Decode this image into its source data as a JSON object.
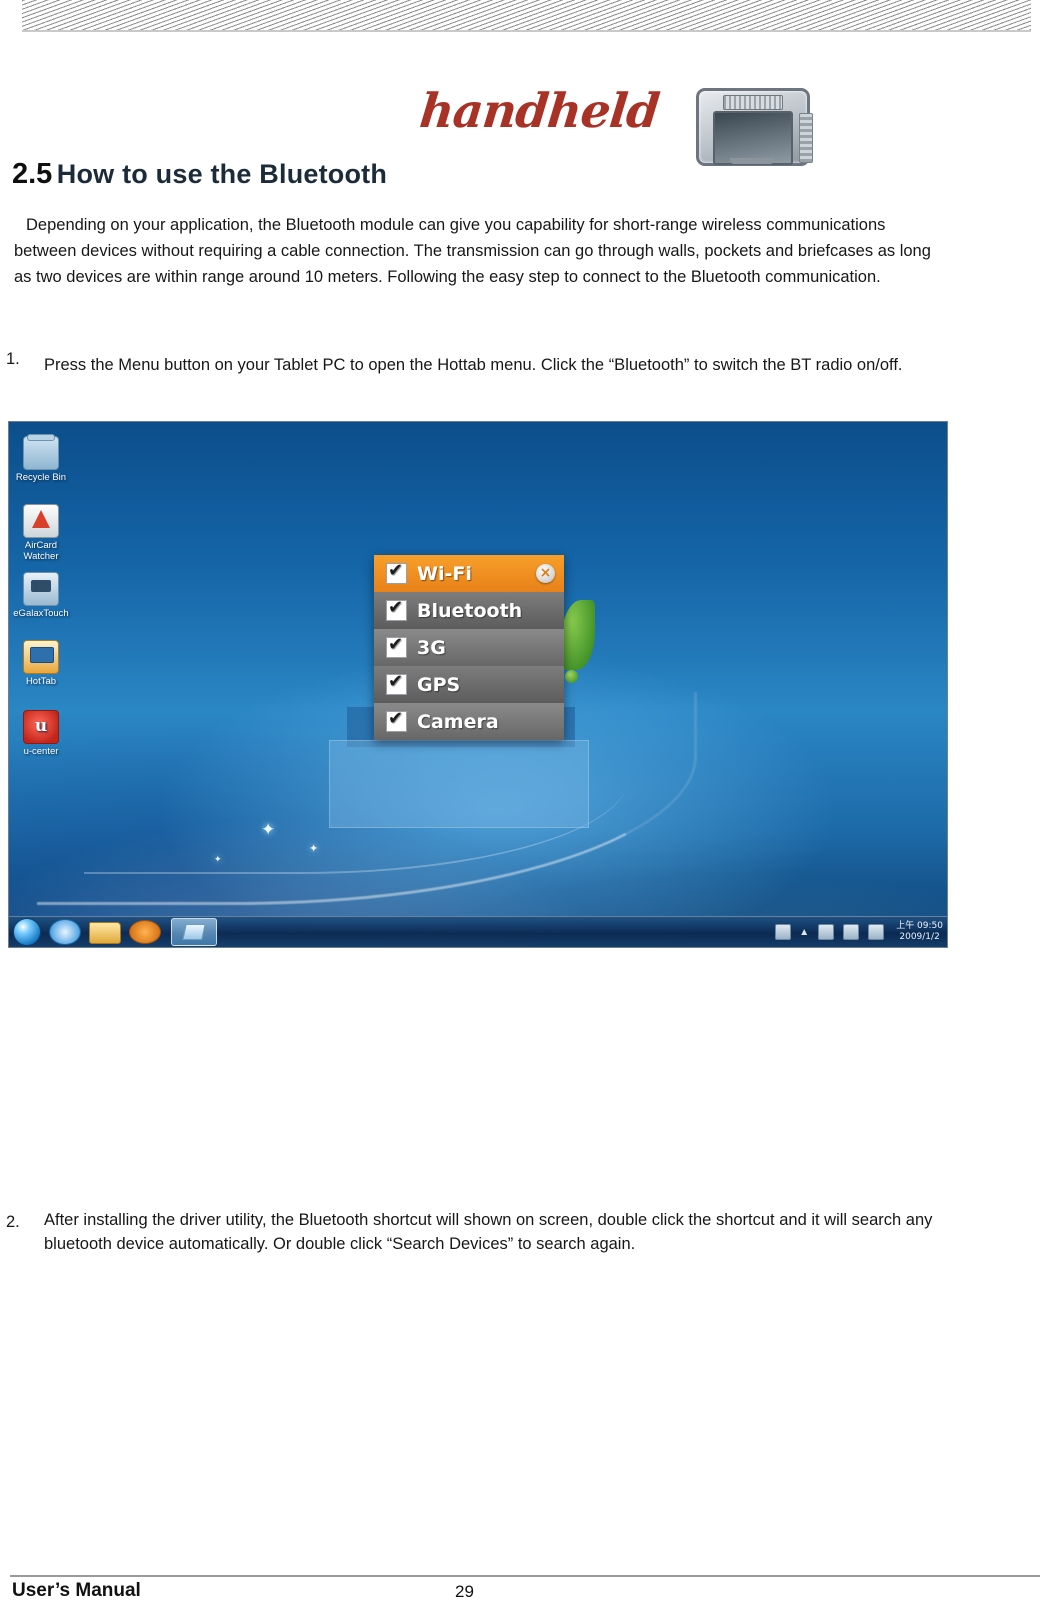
{
  "document": {
    "logo_text": "handheld",
    "heading_number": "2.5",
    "heading_title": "How to use the Bluetooth",
    "intro_paragraph": "Depending on your application, the Bluetooth module can give you capability for short-range wireless communications between devices without requiring a cable connection. The transmission can go through walls, pockets and briefcases as long as two devices are within range around 10 meters. Following the easy step to connect to the Bluetooth communication.",
    "steps": [
      {
        "number": "1.",
        "text": "Press the Menu button on your Tablet PC to open the Hottab menu. Click the “Bluetooth” to switch the BT radio on/off."
      },
      {
        "number": "2.",
        "text": "After installing the driver utility, the Bluetooth shortcut will shown on screen, double click the shortcut and it will search any bluetooth device automatically. Or double click “Search Devices” to search again."
      }
    ],
    "footer": {
      "left_label": "User’s Manual",
      "page_number": "29"
    }
  },
  "screenshot": {
    "desktop_icons": [
      {
        "label": "Recycle Bin",
        "icon": "recycle-bin-icon"
      },
      {
        "label": "AirCard\nWatcher",
        "icon": "aircard-watcher-icon"
      },
      {
        "label": "eGalaxTouch",
        "icon": "egalaxtouch-icon"
      },
      {
        "label": "HotTab",
        "icon": "hottab-icon"
      },
      {
        "label": "u-center",
        "icon": "ucenter-icon"
      }
    ],
    "hottab_menu": {
      "close_label": "×",
      "items": [
        {
          "label": "Wi-Fi",
          "checked": true
        },
        {
          "label": "Bluetooth",
          "checked": true
        },
        {
          "label": "3G",
          "checked": true
        },
        {
          "label": "GPS",
          "checked": true
        },
        {
          "label": "Camera",
          "checked": true
        }
      ]
    },
    "taskbar": {
      "start_icon": "windows-start-orb-icon",
      "buttons": [
        "internet-explorer-icon",
        "folder-explorer-icon",
        "media-player-icon",
        "active-window-button"
      ],
      "tray_icons": [
        "keyboard-icon",
        "battery-icon",
        "network-icon",
        "volume-icon"
      ],
      "tray_overflow": "▲",
      "clock_time": "上午 09:50",
      "clock_date": "2009/1/2"
    },
    "colors": {
      "accent_orange": "#e8811a",
      "menu_gray": "#6b6b6b",
      "desktop_blue": "#1566a8"
    }
  }
}
